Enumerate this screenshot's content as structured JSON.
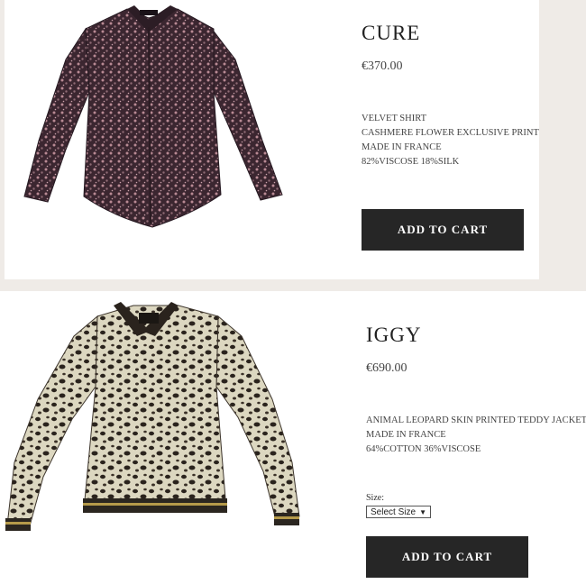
{
  "products": [
    {
      "name": "CURE",
      "price": "€370.00",
      "description": [
        "VELVET SHIRT",
        "CASHMERE FLOWER EXCLUSIVE PRINT",
        "MADE IN FRANCE",
        "82%VISCOSE 18%SILK"
      ],
      "add_to_cart": "ADD TO CART"
    },
    {
      "name": "IGGY",
      "price": "€690.00",
      "description": [
        "ANIMAL LEOPARD SKIN PRINTED TEDDY JACKET",
        "MADE IN FRANCE",
        "64%COTTON 36%VISCOSE"
      ],
      "size_label": "Size:",
      "size_selected": "Select Size",
      "add_to_cart": "ADD TO CART"
    }
  ],
  "colors": {
    "background": "#efebe7",
    "card": "#ffffff",
    "button": "#262626",
    "shirt": "#3c2a30",
    "jacket": "#d8d3bd",
    "spots": "#2a231d"
  }
}
